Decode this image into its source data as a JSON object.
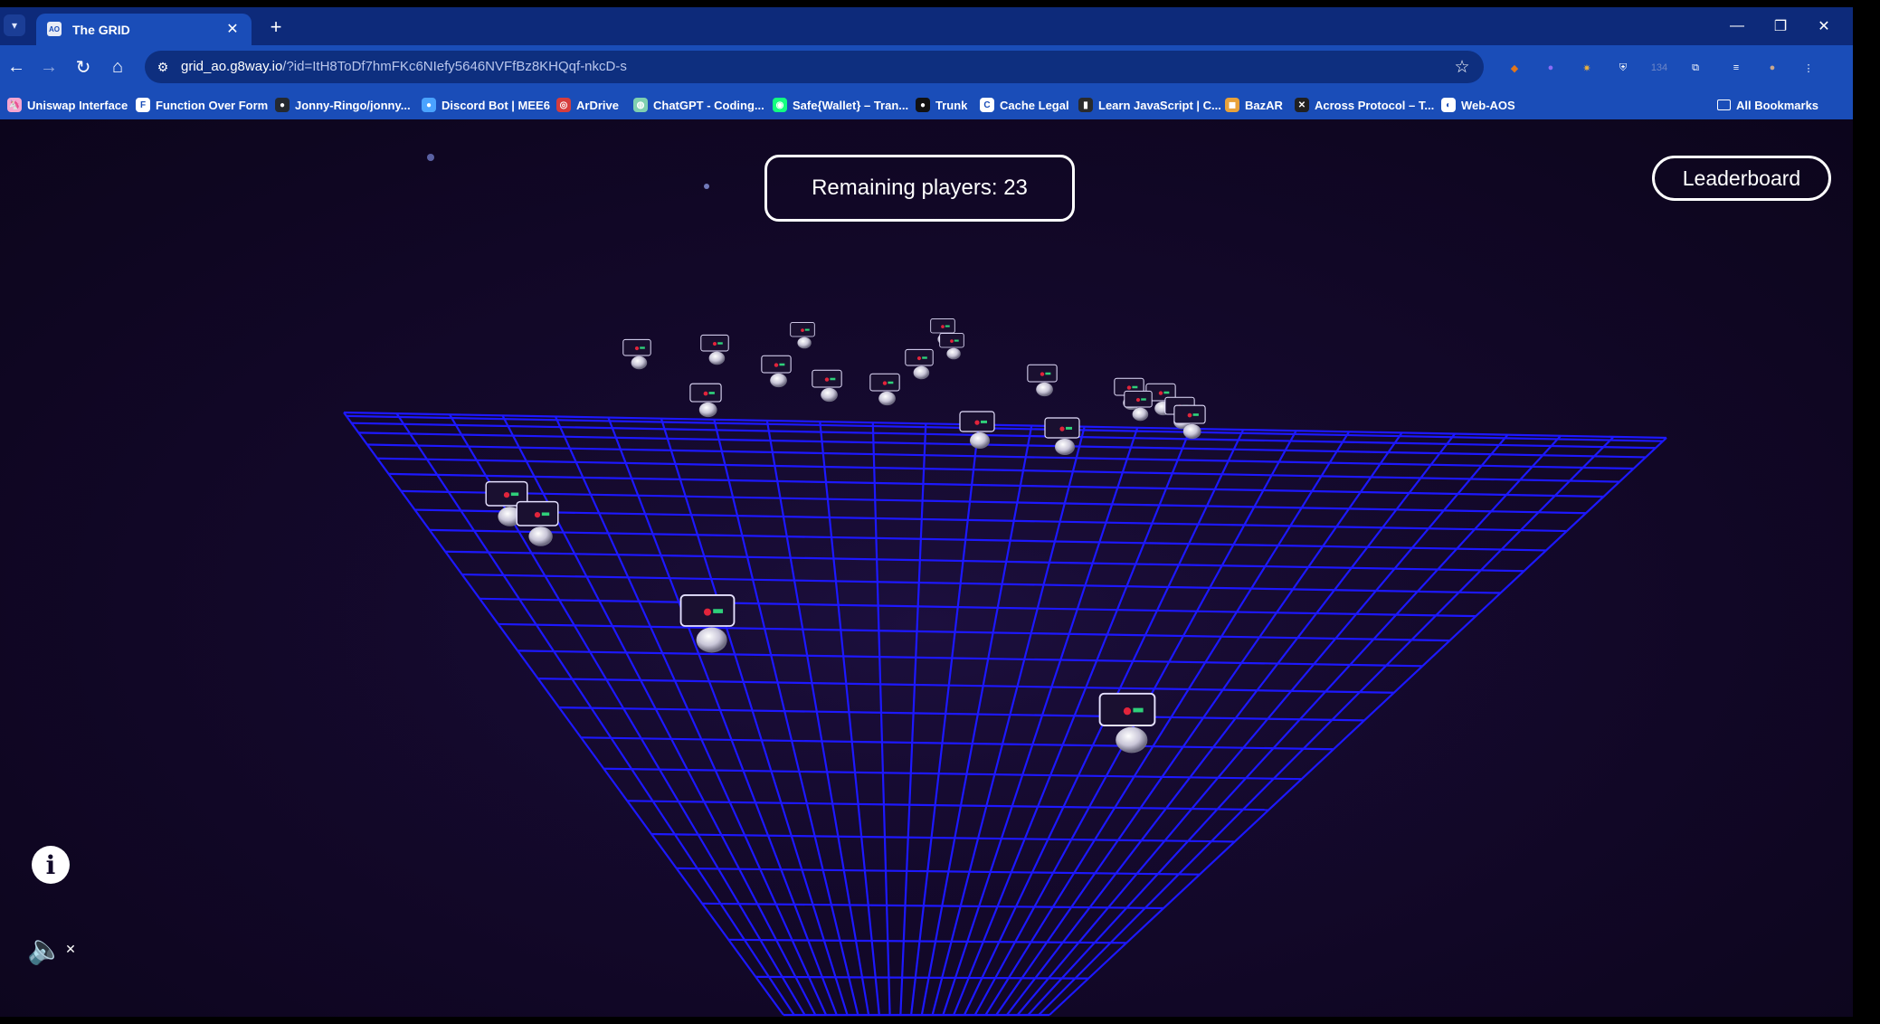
{
  "browser": {
    "tab": {
      "favicon": "AO",
      "title": "The GRID",
      "close": "✕"
    },
    "new_tab": "+",
    "window_controls": {
      "minimize": "—",
      "restore": "❐",
      "close": "✕"
    },
    "nav": {
      "back": "←",
      "forward": "→",
      "reload": "↻",
      "home": "⌂"
    },
    "url": {
      "host": "grid_ao.g8way.io",
      "path": "/?id=ItH8ToDf7hmFKc6NIefy5646NVFfBz8KHQqf-nkcD-s"
    },
    "extensions": [
      {
        "name": "metamask-icon",
        "color": "#e2761b",
        "glyph": "◆"
      },
      {
        "name": "wallet-extension-icon",
        "color": "#8b6cf6",
        "glyph": "●"
      },
      {
        "name": "sparkle-extension-icon",
        "color": "#f0b33b",
        "glyph": "✷"
      },
      {
        "name": "shield-extension-icon",
        "color": "#ffffff",
        "glyph": "⛨"
      },
      {
        "name": "badge-extension-icon",
        "color": "#6e86c6",
        "glyph": "134"
      },
      {
        "name": "extensions-puzzle-icon",
        "color": "#ffffff",
        "glyph": "⧉"
      },
      {
        "name": "media-controls-icon",
        "color": "#ffffff",
        "glyph": "≡"
      },
      {
        "name": "profile-avatar",
        "color": "#c9a88e",
        "glyph": "●"
      },
      {
        "name": "browser-menu-icon",
        "color": "#ffffff",
        "glyph": "⋮"
      }
    ],
    "bookmarks": [
      {
        "label": "Uniswap Interface",
        "icon_color": "#f6a5d0",
        "glyph": "🦄"
      },
      {
        "label": "Function Over Form",
        "icon_color": "#ffffff",
        "glyph": "F"
      },
      {
        "label": "Jonny-Ringo/jonny...",
        "icon_color": "#24292f",
        "glyph": "●"
      },
      {
        "label": "Discord Bot | MEE6",
        "icon_color": "#4aa3ff",
        "glyph": "●"
      },
      {
        "label": "ArDrive",
        "icon_color": "#d63d3d",
        "glyph": "◎"
      },
      {
        "label": "ChatGPT - Coding...",
        "icon_color": "#7fd0b0",
        "glyph": "◍"
      },
      {
        "label": "Safe{Wallet} – Tran...",
        "icon_color": "#12ff80",
        "glyph": "◉"
      },
      {
        "label": "Trunk",
        "icon_color": "#111111",
        "glyph": "●"
      },
      {
        "label": "Cache Legal",
        "icon_color": "#ffffff",
        "glyph": "C"
      },
      {
        "label": "Learn JavaScript | C...",
        "icon_color": "#2a2a2a",
        "glyph": "▮"
      },
      {
        "label": "BazAR",
        "icon_color": "#e8a23a",
        "glyph": "◼"
      },
      {
        "label": "Across Protocol – T...",
        "icon_color": "#202020",
        "glyph": "✕"
      },
      {
        "label": "Web-AOS",
        "icon_color": "#ffffff",
        "glyph": "◐"
      }
    ],
    "all_bookmarks": "All Bookmarks"
  },
  "game": {
    "remaining_players_text": "Remaining players: 23",
    "leaderboard_label": "Leaderboard",
    "info_label": "i",
    "mute_label": "🔈",
    "grid_color": "#1d18ff",
    "background_color": "#110726"
  }
}
